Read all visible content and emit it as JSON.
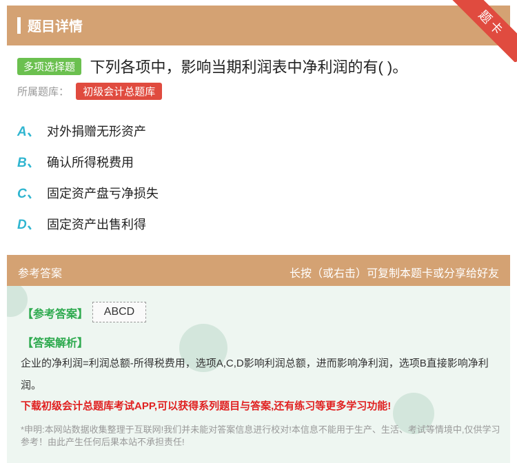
{
  "header": {
    "title": "题目详情",
    "ribbon": "题卡"
  },
  "question": {
    "type": "多项选择题",
    "text": "下列各项中，影响当期利润表中净利润的有( )。",
    "bank_label": "所属题库：",
    "bank": "初级会计总题库"
  },
  "options": [
    {
      "letter": "A、",
      "text": "对外捐赠无形资产"
    },
    {
      "letter": "B、",
      "text": "确认所得税费用"
    },
    {
      "letter": "C、",
      "text": "固定资产盘亏净损失"
    },
    {
      "letter": "D、",
      "text": "固定资产出售利得"
    }
  ],
  "answer": {
    "head_left": "参考答案",
    "head_right": "长按（或右击）可复制本题卡或分享给好友",
    "ref_label": "【参考答案】",
    "ref_value": "ABCD",
    "analysis_label": "【答案解析】",
    "analysis_text": "企业的净利润=利润总额-所得税费用，选项A,C,D影响利润总额，进而影响净利润，选项B直接影响净利润。",
    "promo": "下载初级会计总题库考试APP,可以获得系列题目与答案,还有练习等更多学习功能!",
    "disclaimer": "*申明:本网站数据收集整理于互联网!我们并未能对答案信息进行校对!本信息不能用于生产、生活、考试等情境中,仅供学习参考！由此产生任何后果本站不承担责任!"
  },
  "colors": {
    "header": "#d4a273",
    "accent_green": "#6bc04f",
    "accent_red": "#e04b3f",
    "option_letter": "#2fb5d0"
  }
}
